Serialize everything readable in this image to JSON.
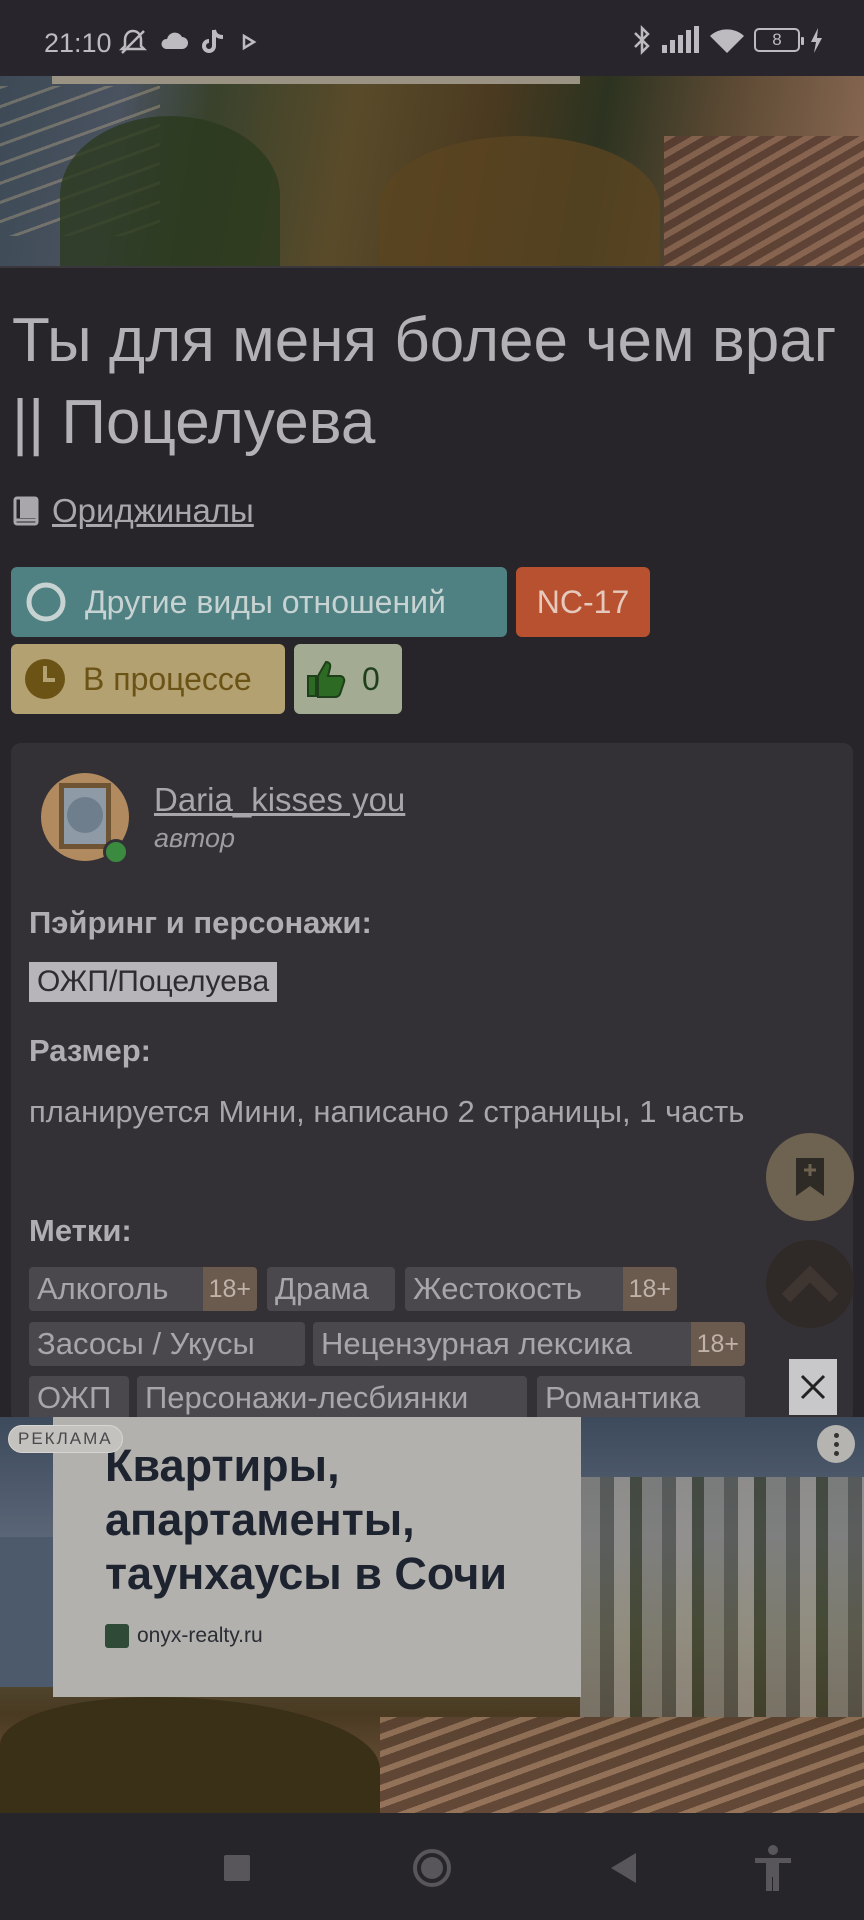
{
  "status_bar": {
    "time": "21:10",
    "battery": "8"
  },
  "story": {
    "title": "Ты для меня более чем враг || Поцелуева",
    "fandom": "Ориджиналы",
    "direction": "Другие виды отношений",
    "rating": "NC-17",
    "status": "В процессе",
    "likes": "0"
  },
  "info": {
    "author_name": "Daria_kisses you",
    "author_role": "автор",
    "pairing_label": "Пэйринг и персонажи:",
    "pairing_value": "ОЖП/Поцелуева",
    "size_label": "Размер:",
    "size_value": "планируется Мини, написано 2 страницы, 1 часть",
    "tags_label": "Метки:",
    "tags": [
      {
        "name": "Алкоголь",
        "age": "18+"
      },
      {
        "name": "Драма",
        "age": ""
      },
      {
        "name": "Жестокость",
        "age": "18+"
      },
      {
        "name": "Засосы / Укусы",
        "age": ""
      },
      {
        "name": "Нецензурная лексика",
        "age": "18+"
      },
      {
        "name": "ОЖП",
        "age": ""
      },
      {
        "name": "Персонажи-лесбиянки",
        "age": ""
      },
      {
        "name": "Романтика",
        "age": ""
      }
    ]
  },
  "ad": {
    "badge": "РЕКЛАМА",
    "headline": "Квартиры, апартаменты, таунхаусы в Сочи",
    "domain": "onyx-realty.ru"
  },
  "colors": {
    "background": "#27252a",
    "direction_chip": "#508182",
    "rating_chip": "#b8512f",
    "status_chip": "#b4a171",
    "likes_chip": "#a3ab93"
  },
  "icons": [
    "mute-icon",
    "cloud-icon",
    "tiktok-icon",
    "play-icon",
    "bluetooth-icon",
    "signal-icon",
    "wifi-icon",
    "battery-icon",
    "charging-icon",
    "book-icon",
    "circle-icon",
    "clock-icon",
    "thumbs-up-icon",
    "bookmark-add-icon",
    "chevron-up-icon",
    "close-icon",
    "more-icon",
    "square-icon",
    "home-icon",
    "back-icon",
    "accessibility-icon"
  ]
}
